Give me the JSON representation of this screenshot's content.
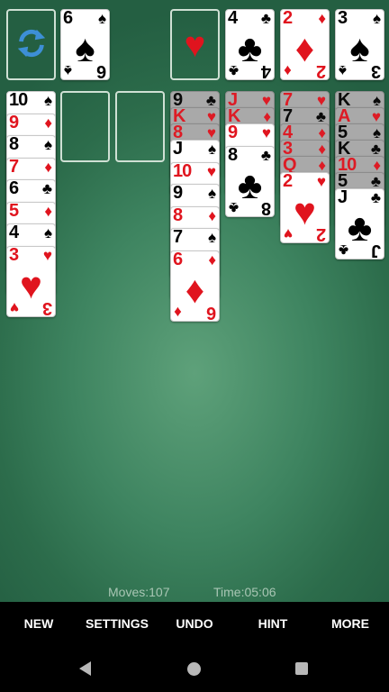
{
  "stock": {
    "icon": "recycle-icon"
  },
  "waste": {
    "rank": "6",
    "suit": "♠",
    "color": "blk"
  },
  "foundations": [
    {
      "empty": true,
      "suit": "♥"
    },
    {
      "rank": "4",
      "suit": "♣",
      "color": "blk"
    },
    {
      "rank": "2",
      "suit": "♦",
      "color": "red"
    },
    {
      "rank": "3",
      "suit": "♠",
      "color": "blk"
    }
  ],
  "tableau": [
    {
      "cards": [
        {
          "rank": "10",
          "suit": "♠",
          "color": "blk"
        },
        {
          "rank": "9",
          "suit": "♦",
          "color": "red"
        },
        {
          "rank": "8",
          "suit": "♠",
          "color": "blk"
        },
        {
          "rank": "7",
          "suit": "♦",
          "color": "red"
        },
        {
          "rank": "6",
          "suit": "♣",
          "color": "blk"
        },
        {
          "rank": "5",
          "suit": "♦",
          "color": "red"
        },
        {
          "rank": "4",
          "suit": "♠",
          "color": "blk"
        },
        {
          "rank": "3",
          "suit": "♥",
          "color": "red"
        }
      ]
    },
    {
      "cards": []
    },
    {
      "cards": []
    },
    {
      "cards": [
        {
          "rank": "9",
          "suit": "♣",
          "color": "blk",
          "down": true
        },
        {
          "rank": "K",
          "suit": "♥",
          "color": "red",
          "down": true
        },
        {
          "rank": "8",
          "suit": "♥",
          "color": "red",
          "down": true
        },
        {
          "rank": "J",
          "suit": "♠",
          "color": "blk"
        },
        {
          "rank": "10",
          "suit": "♥",
          "color": "red"
        },
        {
          "rank": "9",
          "suit": "♠",
          "color": "blk"
        },
        {
          "rank": "8",
          "suit": "♦",
          "color": "red"
        },
        {
          "rank": "7",
          "suit": "♠",
          "color": "blk"
        },
        {
          "rank": "6",
          "suit": "♦",
          "color": "red"
        }
      ]
    },
    {
      "cards": [
        {
          "rank": "J",
          "suit": "♥",
          "color": "red",
          "down": true
        },
        {
          "rank": "K",
          "suit": "♦",
          "color": "red",
          "down": true
        },
        {
          "rank": "9",
          "suit": "♥",
          "color": "red"
        },
        {
          "rank": "8",
          "suit": "♣",
          "color": "blk"
        }
      ]
    },
    {
      "cards": [
        {
          "rank": "7",
          "suit": "♥",
          "color": "red",
          "down": true
        },
        {
          "rank": "7",
          "suit": "♣",
          "color": "blk",
          "down": true
        },
        {
          "rank": "4",
          "suit": "♦",
          "color": "red",
          "down": true
        },
        {
          "rank": "3",
          "suit": "♦",
          "color": "red",
          "down": true
        },
        {
          "rank": "Q",
          "suit": "♦",
          "color": "red",
          "down": true
        },
        {
          "rank": "2",
          "suit": "♥",
          "color": "red"
        }
      ]
    },
    {
      "cards": [
        {
          "rank": "K",
          "suit": "♠",
          "color": "blk",
          "down": true
        },
        {
          "rank": "A",
          "suit": "♥",
          "color": "red",
          "down": true
        },
        {
          "rank": "5",
          "suit": "♠",
          "color": "blk",
          "down": true
        },
        {
          "rank": "K",
          "suit": "♣",
          "color": "blk",
          "down": true
        },
        {
          "rank": "10",
          "suit": "♦",
          "color": "red",
          "down": true
        },
        {
          "rank": "5",
          "suit": "♣",
          "color": "blk",
          "down": true
        },
        {
          "rank": "J",
          "suit": "♣",
          "color": "blk"
        }
      ]
    }
  ],
  "status": {
    "moves": "Moves:107",
    "time": "Time:05:06"
  },
  "menu": {
    "new": "NEW",
    "settings": "SETTINGS",
    "undo": "UNDO",
    "hint": "HINT",
    "more": "MORE"
  },
  "colors": {
    "felt": "#3e8460",
    "red_suit": "#e0141e",
    "face_down": "#a9a9a9"
  }
}
